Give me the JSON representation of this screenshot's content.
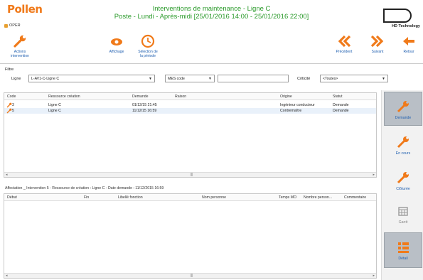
{
  "app": {
    "logo": "Pollen",
    "operator": "OPER",
    "title_line1": "Interventions de maintenance - Ligne C",
    "title_line2": "Poste - Lundi - Après-midi [25/01/2016 14:00 - 25/01/2016 22:00]",
    "brand": "HD Technology"
  },
  "toolbar": {
    "actions_line1": "Actions",
    "actions_line2": "intervention",
    "affichage": "Affichage",
    "periode_line1": "Sélection de",
    "periode_line2": "la période",
    "precedent": "Précédent",
    "suivant": "Suivant",
    "retour": "Retour"
  },
  "filter": {
    "legend": "Filtre",
    "ligne_label": "Ligne",
    "ligne_value": "L-AV1-C-Ligne C",
    "mes_code": "MES code",
    "criticite_label": "Criticité",
    "criticite_value": "<Toutes>"
  },
  "interventions": {
    "columns": [
      "Code",
      "Ressource création",
      "Demande",
      "Raison",
      "Origine",
      "Statut"
    ],
    "rows": [
      {
        "code": "3",
        "ressource": "Ligne C",
        "demande": "01/12/15 21:45",
        "raison": "",
        "origine": "Ingénieur conducteur",
        "statut": "Demande"
      },
      {
        "code": "5",
        "ressource": "Ligne C",
        "demande": "11/12/15 16:59",
        "raison": "",
        "origine": "Contremaître",
        "statut": "Demande"
      }
    ]
  },
  "affectation": {
    "text": "Affectation _ Intervention 5 - Ressource de création : Ligne C - Date demande : 11/12/2015 16:59",
    "columns": [
      "Début",
      "Fin",
      "Libellé fonction",
      "Nom personne",
      "Temps MO",
      "Nombre person...",
      "Commentaire"
    ]
  },
  "sidebar": {
    "demande": "Demande",
    "en_cours": "En cours",
    "cloturee": "Clôturée",
    "gantt": "Gantt",
    "detail": "Détail"
  },
  "colors": {
    "accent_orange": "#f07a1a",
    "title_green": "#2a9a2a",
    "link_blue": "#1f5fb0"
  }
}
